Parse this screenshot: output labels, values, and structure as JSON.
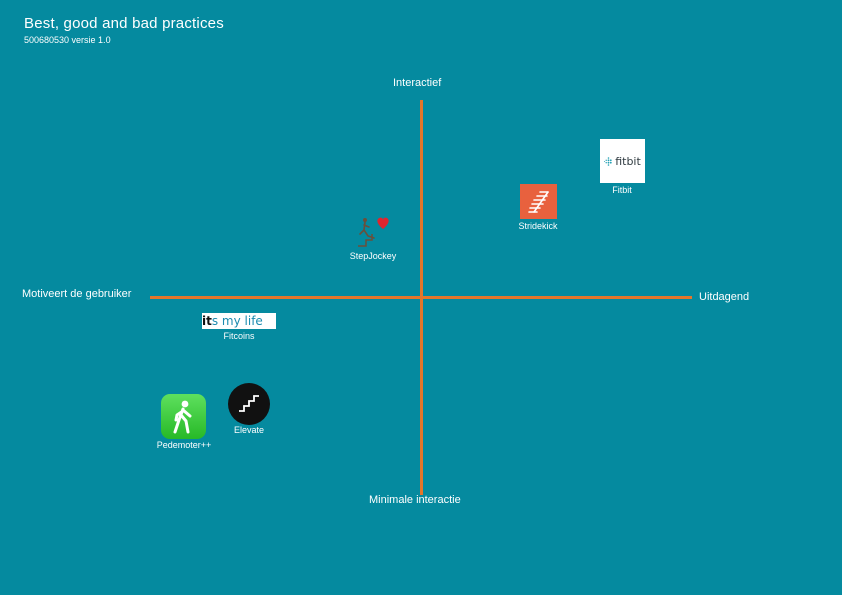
{
  "header": {
    "title": "Best, good and bad practices",
    "subtitle": "500680530 versie 1.0"
  },
  "axes": {
    "top": "Interactief",
    "bottom": "Minimale interactie",
    "left": "Motiveert de gebruiker",
    "right": "Uitdagend"
  },
  "apps": [
    {
      "name": "Fitbit",
      "icon": "fitbit-logo-icon",
      "logo_text": "fitbit"
    },
    {
      "name": "Stridekick",
      "icon": "stridekick-logo-icon",
      "color": "#e8613e"
    },
    {
      "name": "StepJockey",
      "icon": "stepjockey-logo-icon",
      "color": "#e0242e"
    },
    {
      "name": "Fitcoins",
      "icon": "itsmylife-logo-icon",
      "logo_text_bold": "it",
      "logo_text": "s my life"
    },
    {
      "name": "Elevate",
      "icon": "stairs-icon",
      "color": "#111111"
    },
    {
      "name": "Pedemoter++",
      "icon": "walking-person-icon",
      "color": "#3dcf3d"
    }
  ],
  "colors": {
    "background": "#058a9f",
    "axis": "#e5762a"
  }
}
